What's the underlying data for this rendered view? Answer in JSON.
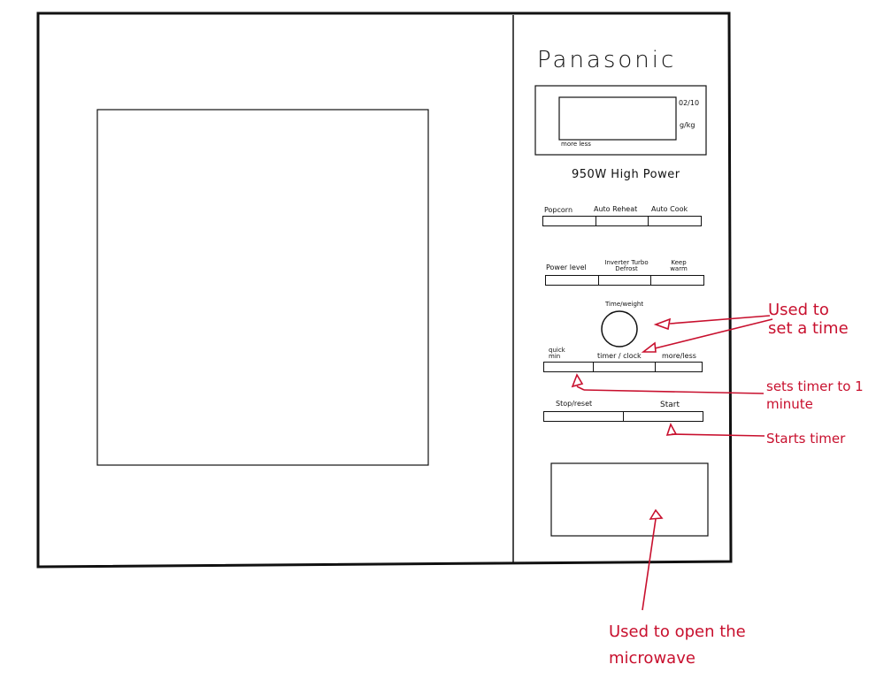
{
  "brand": "Panasonic",
  "display": {
    "side_top": "02/10",
    "side_bottom": "g/kg",
    "bottom_label": "more less"
  },
  "power_label": "950W High Power",
  "buttons": {
    "row1": [
      "Popcorn",
      "Auto Reheat",
      "Auto Cook"
    ],
    "row2": [
      "Power level",
      "Inverter Turbo Defrost",
      "Keep warm"
    ],
    "dial_label": "Time/weight",
    "row3": [
      "quick min",
      "timer / clock",
      "more/less"
    ],
    "row4": [
      "Stop/reset",
      "Start"
    ]
  },
  "annotations": {
    "set_time": "Used to set a time",
    "one_minute": "sets timer to 1 minute",
    "starts_timer": "Starts timer",
    "open": "Used to open the microwave"
  },
  "colors": {
    "ink": "#111111",
    "annotation": "#c8102e",
    "background": "#ffffff"
  }
}
